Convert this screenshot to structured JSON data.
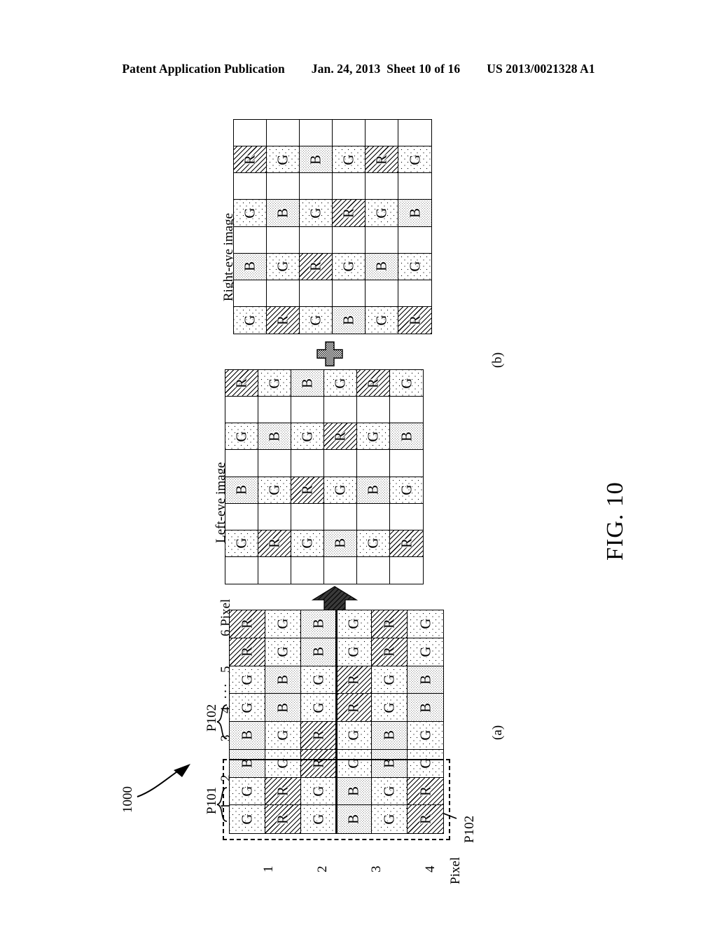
{
  "header": {
    "publication": "Patent Application Publication",
    "date": "Jan. 24, 2013",
    "sheet": "Sheet 10 of 16",
    "docnum": "US 2013/0021328 A1"
  },
  "figure": {
    "caption": "FIG. 10",
    "panel_a_label": "(a)",
    "panel_b_label": "(b)",
    "device_ref": "1000",
    "ref_P101": "P101",
    "ref_P102_top": "P102",
    "ref_P102_bottom": "P102",
    "plus_symbol": "+",
    "combine_arrow": "up-arrow"
  },
  "panel_a": {
    "title": "",
    "col_axis_label": "Pixel",
    "col_ticks": [
      "1",
      "2",
      "3",
      "4",
      "5",
      "6"
    ],
    "col_ticks_suffix": "6 Pixel",
    "ellipsis": "···",
    "row_axis_label": "Pixel",
    "row_ticks": [
      "1",
      "2",
      "3",
      "4"
    ],
    "grid_cols": 8,
    "grid_rows": 6,
    "cells": [
      [
        "G",
        "G",
        "B",
        "B",
        "G",
        "G",
        "R",
        "R"
      ],
      [
        "R",
        "R",
        "G",
        "G",
        "B",
        "B",
        "G",
        "G"
      ],
      [
        "G",
        "G",
        "R",
        "R",
        "G",
        "G",
        "B",
        "B"
      ],
      [
        "B",
        "B",
        "G",
        "G",
        "R",
        "R",
        "G",
        "G"
      ],
      [
        "G",
        "G",
        "B",
        "B",
        "G",
        "G",
        "R",
        "R"
      ],
      [
        "R",
        "R",
        "G",
        "G",
        "B",
        "B",
        "G",
        "G"
      ]
    ]
  },
  "panel_left_eye": {
    "title": "Left-eye image",
    "grid_cols": 8,
    "grid_rows": 6,
    "cells": [
      [
        "G",
        "",
        "B",
        "",
        "G",
        "",
        "R",
        ""
      ],
      [
        "R",
        "",
        "G",
        "",
        "B",
        "",
        "G",
        ""
      ],
      [
        "G",
        "",
        "R",
        "",
        "G",
        "",
        "B",
        ""
      ],
      [
        "B",
        "",
        "G",
        "",
        "R",
        "",
        "G",
        ""
      ],
      [
        "G",
        "",
        "B",
        "",
        "G",
        "",
        "R",
        ""
      ],
      [
        "R",
        "",
        "G",
        "",
        "B",
        "",
        "G",
        ""
      ]
    ]
  },
  "panel_right_eye": {
    "title": "Right-eye image",
    "grid_cols": 8,
    "grid_rows": 6,
    "cells": [
      [
        "",
        "G",
        "",
        "B",
        "",
        "G",
        "",
        "R"
      ],
      [
        "",
        "R",
        "",
        "G",
        "",
        "B",
        "",
        "G"
      ],
      [
        "",
        "G",
        "",
        "R",
        "",
        "G",
        "",
        "B"
      ],
      [
        "",
        "B",
        "",
        "G",
        "",
        "R",
        "",
        "G"
      ],
      [
        "",
        "G",
        "",
        "B",
        "",
        "G",
        "",
        "R"
      ],
      [
        "",
        "R",
        "",
        "G",
        "",
        "B",
        "",
        "G"
      ]
    ]
  },
  "legend": {
    "R": "R",
    "G": "G",
    "B": "B"
  }
}
